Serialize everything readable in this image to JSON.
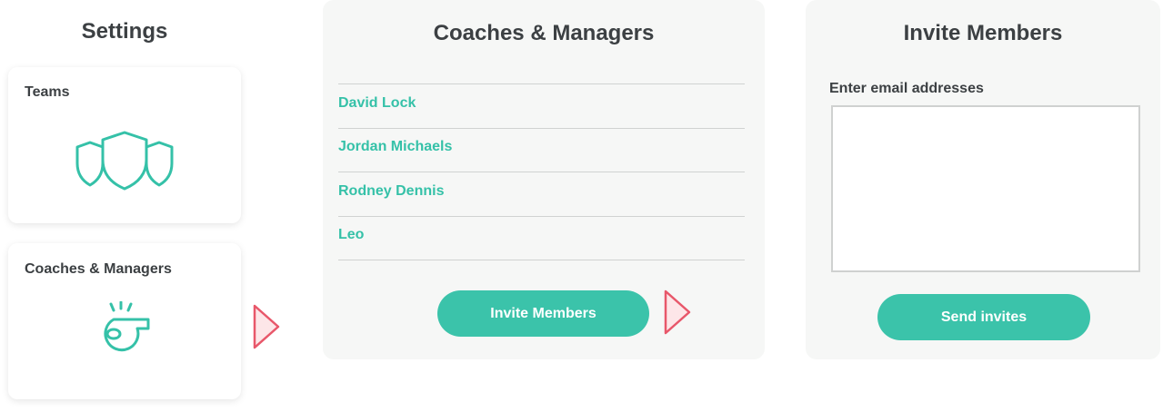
{
  "settings": {
    "title": "Settings",
    "tiles": [
      {
        "label": "Teams",
        "icon": "shields-icon"
      },
      {
        "label": "Coaches & Managers",
        "icon": "whistle-icon"
      }
    ]
  },
  "coaches_panel": {
    "title": "Coaches & Managers",
    "members": [
      "David Lock",
      "Jordan Michaels",
      "Rodney Dennis",
      "Leo"
    ],
    "invite_button": "Invite Members"
  },
  "invite_panel": {
    "title": "Invite Members",
    "email_label": "Enter email addresses",
    "email_value": "",
    "send_button": "Send invites"
  },
  "colors": {
    "accent": "#3bc3aa",
    "panel_bg": "#f6f7f6",
    "arrow_stroke": "#e8576a",
    "arrow_fill": "#fde6e8"
  }
}
